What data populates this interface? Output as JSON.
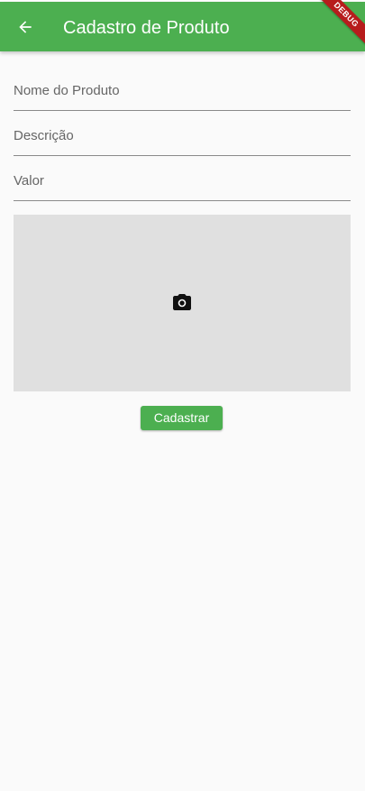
{
  "app_bar": {
    "title": "Cadastro de Produto",
    "back_icon": "arrow-back-icon",
    "background_color": "#4caf50",
    "debug_banner": "DEBUG",
    "debug_banner_color": "#b71c1c"
  },
  "form": {
    "fields": [
      {
        "label": "Nome do Produto"
      },
      {
        "label": "Descrição"
      },
      {
        "label": "Valor"
      }
    ],
    "image_picker": {
      "icon": "camera-icon",
      "background_color": "#e0e0e0"
    },
    "submit_label": "Cadastrar",
    "accent_color": "#4caf50"
  }
}
